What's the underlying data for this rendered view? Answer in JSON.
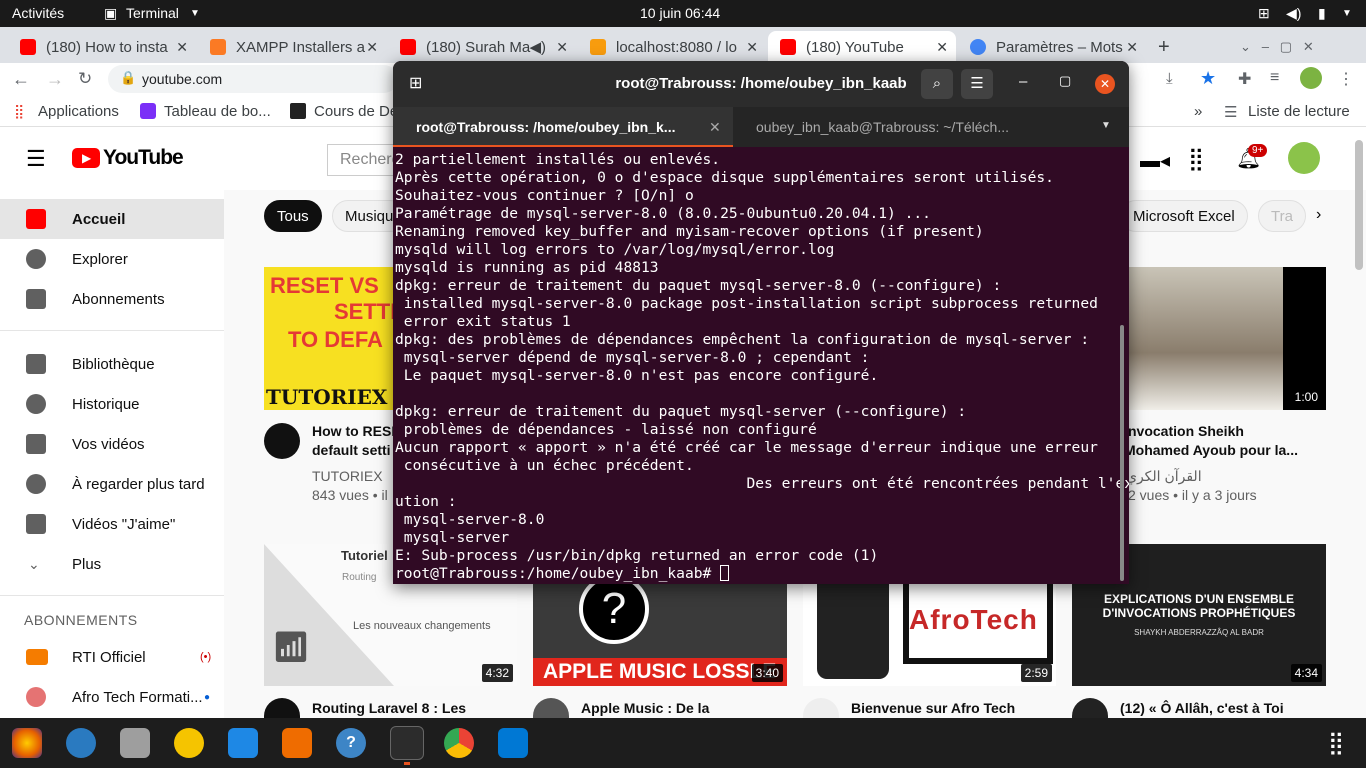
{
  "gnome": {
    "activities": "Activités",
    "app_menu": "Terminal",
    "clock": "10 juin  06:44"
  },
  "browser": {
    "tabs": [
      {
        "label": "(180) How to insta"
      },
      {
        "label": "XAMPP Installers a"
      },
      {
        "label": "(180) Surah Ma"
      },
      {
        "label": "localhost:8080 / lo"
      },
      {
        "label": "(180) YouTube"
      },
      {
        "label": "Paramètres – Mots"
      }
    ],
    "url": "youtube.com",
    "bookmarks": {
      "apps": "Applications",
      "b1": "Tableau de bo...",
      "b2": "Cours de De",
      "reading_list": "Liste de lecture",
      "more": "»"
    }
  },
  "youtube": {
    "logo": "YouTube",
    "search_placeholder": "Recherc",
    "notif_badge": "9+",
    "sidebar": [
      {
        "label": "Accueil"
      },
      {
        "label": "Explorer"
      },
      {
        "label": "Abonnements"
      },
      {
        "label": "Bibliothèque"
      },
      {
        "label": "Historique"
      },
      {
        "label": "Vos vidéos"
      },
      {
        "label": "À regarder plus tard"
      },
      {
        "label": "Vidéos \"J'aime\""
      },
      {
        "label": "Plus"
      }
    ],
    "subs_header": "ABONNEMENTS",
    "subs": [
      {
        "label": "RTI Officiel"
      },
      {
        "label": "Afro Tech Formati..."
      }
    ],
    "chips": [
      "Tous",
      "Musiqu",
      "Microsoft Excel",
      "Tra"
    ],
    "videos": [
      {
        "title1": "How to RESE",
        "title2": "default setti",
        "channel": "TUTORIEX",
        "meta": "843 vues • il",
        "thumb_text1": "RESET VS",
        "thumb_text2": "SETTI",
        "thumb_text3": "TO DEFA",
        "thumb_brand": "TUTORIEX"
      },
      {
        "title1": "nvocation Sheikh",
        "title2": "Mohamed Ayoub pour la...",
        "channel": "القرآن الكري",
        "meta": "2 vues • il y a 3 jours",
        "duration": "1:00"
      },
      {
        "title1": "Routing Laravel 8 : Les",
        "duration": "4:32",
        "thumb_t1": "Tutoriel",
        "thumb_t2": "Routing",
        "thumb_t3": "Les nouveaux changements"
      },
      {
        "title1": "Apple Music : De la",
        "duration": "3:40",
        "thumb_text": "APPLE MUSIC LOSSLE"
      },
      {
        "title1": "Bienvenue sur Afro Tech",
        "duration": "2:59",
        "thumb_text": "AfroTech"
      },
      {
        "title1": "(12) « Ô Allâh, c'est à Toi",
        "duration": "4:34",
        "thumb_t1": "EXPLICATIONS D'UN ENSEMBLE",
        "thumb_t2": "D'INVOCATIONS PROPHÉTIQUES",
        "thumb_t3": "SHAYKH ABDERRAZZÂQ AL BADR"
      }
    ]
  },
  "terminal": {
    "title": "root@Trabrouss: /home/oubey_ibn_kaab",
    "tabs": [
      {
        "label": "root@Trabrouss: /home/oubey_ibn_k..."
      },
      {
        "label": "oubey_ibn_kaab@Trabrouss: ~/Téléch..."
      }
    ],
    "lines": [
      "2 partiellement installés ou enlevés.",
      "Après cette opération, 0 o d'espace disque supplémentaires seront utilisés.",
      "Souhaitez-vous continuer ? [O/n] o",
      "Paramétrage de mysql-server-8.0 (8.0.25-0ubuntu0.20.04.1) ...",
      "Renaming removed key_buffer and myisam-recover options (if present)",
      "mysqld will log errors to /var/log/mysql/error.log",
      "mysqld is running as pid 48813",
      "dpkg: erreur de traitement du paquet mysql-server-8.0 (--configure) :",
      " installed mysql-server-8.0 package post-installation script subprocess returned",
      " error exit status 1",
      "dpkg: des problèmes de dépendances empêchent la configuration de mysql-server :",
      " mysql-server dépend de mysql-server-8.0 ; cependant :",
      " Le paquet mysql-server-8.0 n'est pas encore configuré.",
      "",
      "dpkg: erreur de traitement du paquet mysql-server (--configure) :",
      " problèmes de dépendances - laissé non configuré",
      "Aucun rapport « apport » n'a été créé car le message d'erreur indique une erreur",
      " consécutive à un échec précédent.",
      "                                        Des erreurs ont été rencontrées pendant l'exéc",
      "ution :",
      " mysql-server-8.0",
      " mysql-server",
      "E: Sub-process /usr/bin/dpkg returned an error code (1)",
      "root@Trabrouss:/home/oubey_ibn_kaab# "
    ]
  },
  "colors": {
    "term_bg": "#300a24",
    "yt_red": "#ff0000",
    "accent": "#1a73e8"
  }
}
